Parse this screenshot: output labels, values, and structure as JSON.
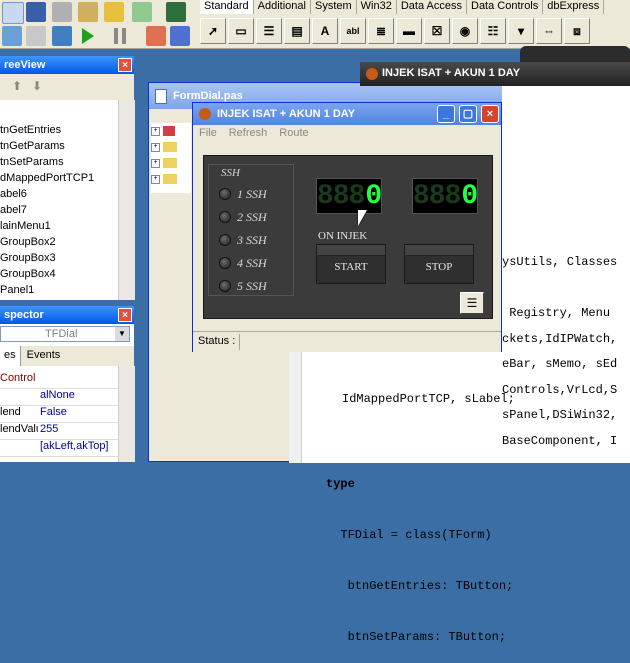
{
  "ide": {
    "palette_tabs": [
      "Standard",
      "Additional",
      "System",
      "Win32",
      "Data Access",
      "Data Controls",
      "dbExpress"
    ],
    "palette_glyphs": [
      "A",
      "abl"
    ]
  },
  "treeview": {
    "title": "reeView",
    "close_glyph": "×",
    "items": [
      "tnGetEntries",
      "tnGetParams",
      "tnSetParams",
      "dMappedPortTCP1",
      "abel6",
      "abel7",
      "lainMenu1",
      "GroupBox2",
      "GroupBox3",
      "GroupBox4",
      "Panel1"
    ]
  },
  "inspector": {
    "title": "spector",
    "object": "TFDial",
    "tabs": [
      "es",
      "Events"
    ],
    "props": [
      {
        "name": "Control",
        "value": ""
      },
      {
        "name": "",
        "value": "alNone"
      },
      {
        "name": "lend",
        "value": "False"
      },
      {
        "name": "lendValu",
        "value": "255"
      },
      {
        "name": "",
        "value": "[akLeft,akTop]"
      }
    ]
  },
  "background_form": {
    "title": "FormDial.pas"
  },
  "back_window": {
    "title": "INJEK ISAT + AKUN 1 DAY"
  },
  "code": {
    "lines": [
      "ysUtils, Classes",
      " Registry, Menu",
      "eBar, sMemo, sEd",
      "sPanel,DSiWin32,",
      "",
      "ckets,IdIPWatch,",
      "Controls,VrLcd,S",
      "BaseComponent, I",
      "IdMappedPortTCP, sLabel;",
      "",
      "type",
      "  TFDial = class(TForm)",
      "   btnGetEntries: TButton;",
      "   btnSetParams: TButton;"
    ]
  },
  "dialog": {
    "title": "INJEK ISAT + AKUN 1 DAY",
    "menu": [
      "File",
      "Refresh",
      "Route"
    ],
    "group_label": "SSH",
    "ssh": [
      "1 SSH",
      "2 SSH",
      "3 SSH",
      "4 SSH",
      "5 SSH"
    ],
    "lcd1": {
      "dim": "888",
      "lit": "0"
    },
    "lcd2": {
      "dim": "888",
      "lit": "0"
    },
    "on_inject": "ON INJEK",
    "start": "START",
    "stop": "STOP",
    "status": "Status :"
  }
}
